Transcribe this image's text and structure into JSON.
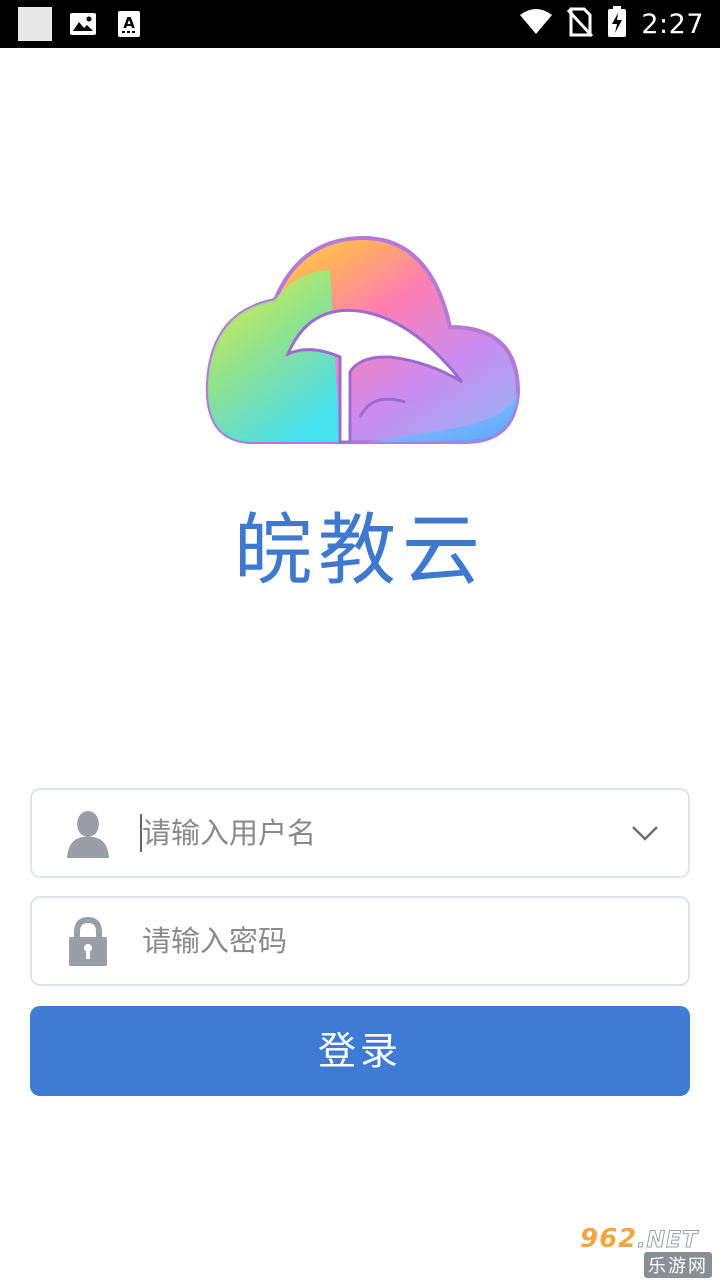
{
  "status_bar": {
    "time": "2:27"
  },
  "app": {
    "name": "皖教云"
  },
  "login_form": {
    "username_placeholder": "请输入用户名",
    "password_placeholder": "请输入密码",
    "login_label": "登录"
  },
  "watermark": {
    "number": "962",
    "domain": ".NET",
    "site_name": "乐游网"
  },
  "colors": {
    "accent": "#3f7bd4",
    "title": "#3f78cf",
    "field_border": "#dfe3ec",
    "icon_gray": "#9a9ea6"
  },
  "icons": {
    "user_field": "person-icon",
    "password_field": "lock-icon",
    "dropdown": "chevron-down-icon"
  }
}
